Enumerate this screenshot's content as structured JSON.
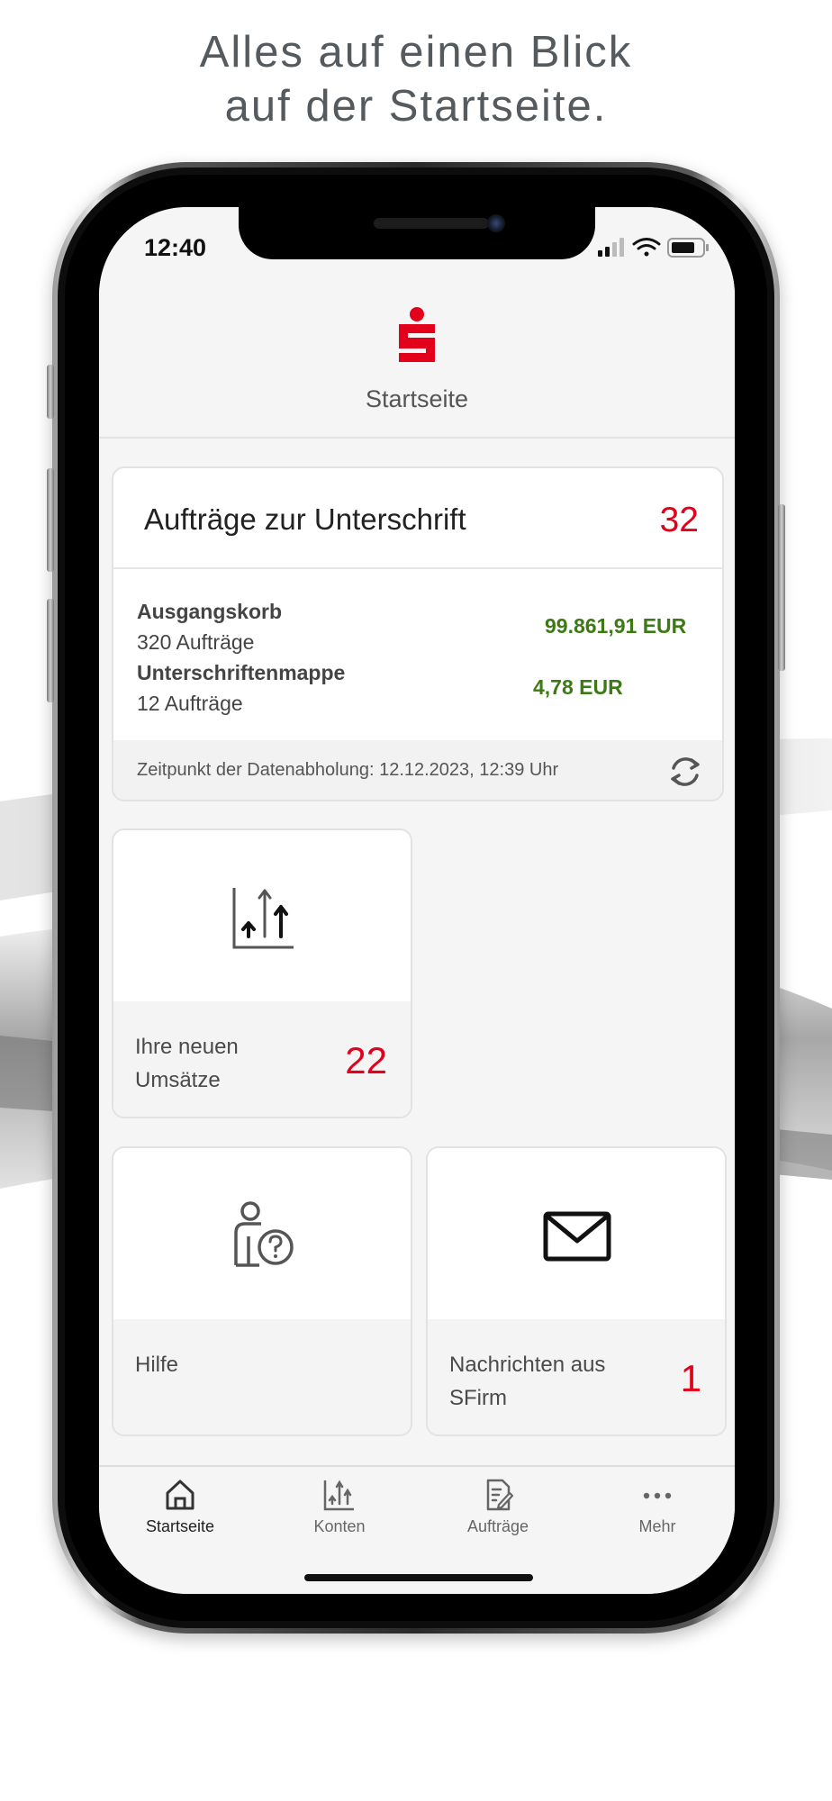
{
  "headline": {
    "line1": "Alles auf einen Blick",
    "line2": "auf der Startseite."
  },
  "status_bar": {
    "time": "12:40",
    "icons": [
      "signal-icon",
      "wifi-icon",
      "battery-icon"
    ]
  },
  "header": {
    "logo": "sparkasse-logo",
    "title": "Startseite"
  },
  "signature_card": {
    "title": "Aufträge zur Unterschrift",
    "count": "32",
    "rows": [
      {
        "name": "Ausgangskorb",
        "sub": "320 Aufträge",
        "amount": "99.861,91 EUR"
      },
      {
        "name": "Unterschriftenmappe",
        "sub": "12 Aufträge",
        "amount": "4,78 EUR"
      }
    ],
    "footer": "Zeitpunkt der Datenabholung: 12.12.2023, 12:39 Uhr",
    "refresh_icon": "refresh-icon"
  },
  "tiles": [
    {
      "label": "Ihre neuen Umsätze",
      "count": "22",
      "icon": "transactions-chart-icon"
    },
    {
      "label": "Hilfe",
      "count": "",
      "icon": "help-person-icon"
    },
    {
      "label": "Nachrichten aus SFirm",
      "count": "1",
      "icon": "envelope-icon"
    }
  ],
  "tabbar": {
    "items": [
      {
        "label": "Startseite",
        "icon": "home-icon",
        "active": true
      },
      {
        "label": "Konten",
        "icon": "accounts-chart-icon",
        "active": false
      },
      {
        "label": "Aufträge",
        "icon": "document-edit-icon",
        "active": false
      },
      {
        "label": "Mehr",
        "icon": "more-dots-icon",
        "active": false
      }
    ]
  },
  "colors": {
    "accent_red": "#e2001a",
    "amount_green": "#3d7a16",
    "screen_bg": "#f5f5f5"
  }
}
